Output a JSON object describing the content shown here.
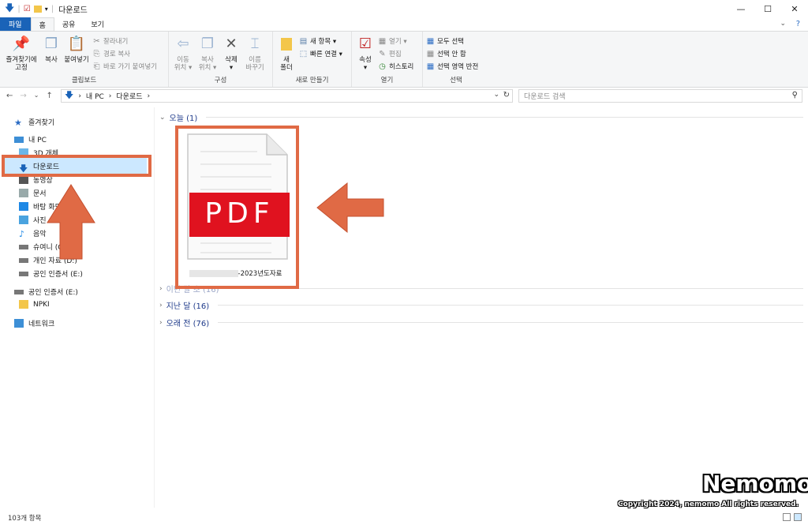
{
  "window": {
    "title": "다운로드"
  },
  "tabs": [
    {
      "label": "파일"
    },
    {
      "label": "홈"
    },
    {
      "label": "공유"
    },
    {
      "label": "보기"
    }
  ],
  "ribbon": {
    "clipboard": {
      "label": "클립보드",
      "pin": "즐겨찾기에\n고정",
      "copy": "복사",
      "paste": "붙여넣기",
      "cut": "잘라내기",
      "copy_path": "경로 복사",
      "paste_shortcut": "바로 가기 붙여넣기"
    },
    "organize": {
      "label": "구성",
      "move_to": "이동\n위치 ▾",
      "copy_to": "복사\n위치 ▾",
      "delete": "삭제\n▾",
      "rename": "이름\n바꾸기"
    },
    "new": {
      "label": "새로 만들기",
      "new_folder": "새\n폴더",
      "new_item": "새 항목 ▾",
      "easy_access": "빠른 연결 ▾"
    },
    "open": {
      "label": "열기",
      "properties": "속성\n▾",
      "open": "열기 ▾",
      "edit": "편집",
      "history": "히스토리"
    },
    "select": {
      "label": "선택",
      "select_all": "모두 선택",
      "select_none": "선택 안 함",
      "invert": "선택 영역 반전"
    }
  },
  "address": {
    "path": [
      "내 PC",
      "다운로드"
    ],
    "search_placeholder": "다운로드 검색"
  },
  "sidebar": {
    "items": [
      {
        "label": "즐겨찾기",
        "icon": "star-icon"
      },
      {
        "label": "내 PC",
        "icon": "pc-icon"
      },
      {
        "label": "3D 개체",
        "icon": "cube-icon"
      },
      {
        "label": "다운로드",
        "icon": "download-icon"
      },
      {
        "label": "동영상",
        "icon": "video-icon"
      },
      {
        "label": "문서",
        "icon": "document-icon"
      },
      {
        "label": "바탕 화면",
        "icon": "desktop-icon"
      },
      {
        "label": "사진",
        "icon": "picture-icon"
      },
      {
        "label": "음악",
        "icon": "music-icon"
      },
      {
        "label": "슈여니 (C:)",
        "icon": "drive-icon"
      },
      {
        "label": "개인 자료 (D:)",
        "icon": "drive-icon"
      },
      {
        "label": "공인 인증서 (E:)",
        "icon": "drive-icon"
      },
      {
        "label": "공인 인증서 (E:)",
        "icon": "drive-icon"
      },
      {
        "label": "NPKI",
        "icon": "folder-icon"
      },
      {
        "label": "네트워크",
        "icon": "network-icon"
      }
    ]
  },
  "groups": [
    {
      "label": "오늘 (1)"
    },
    {
      "label": "이번 달 초 (16)"
    },
    {
      "label": "지난 달 (16)"
    },
    {
      "label": "오래 전 (76)"
    }
  ],
  "file": {
    "icon_text": "PDF",
    "name_suffix": "-2023년도자료"
  },
  "status": {
    "count": "103개 항목"
  },
  "watermark": {
    "brand": "Nemomo",
    "copyright": "Copyright 2024, nemomo All rights reserved."
  },
  "colors": {
    "accent": "#1a63b8",
    "annotation": "#e06a45",
    "pdf_red": "#e0121f",
    "selected": "#cce8ff"
  }
}
